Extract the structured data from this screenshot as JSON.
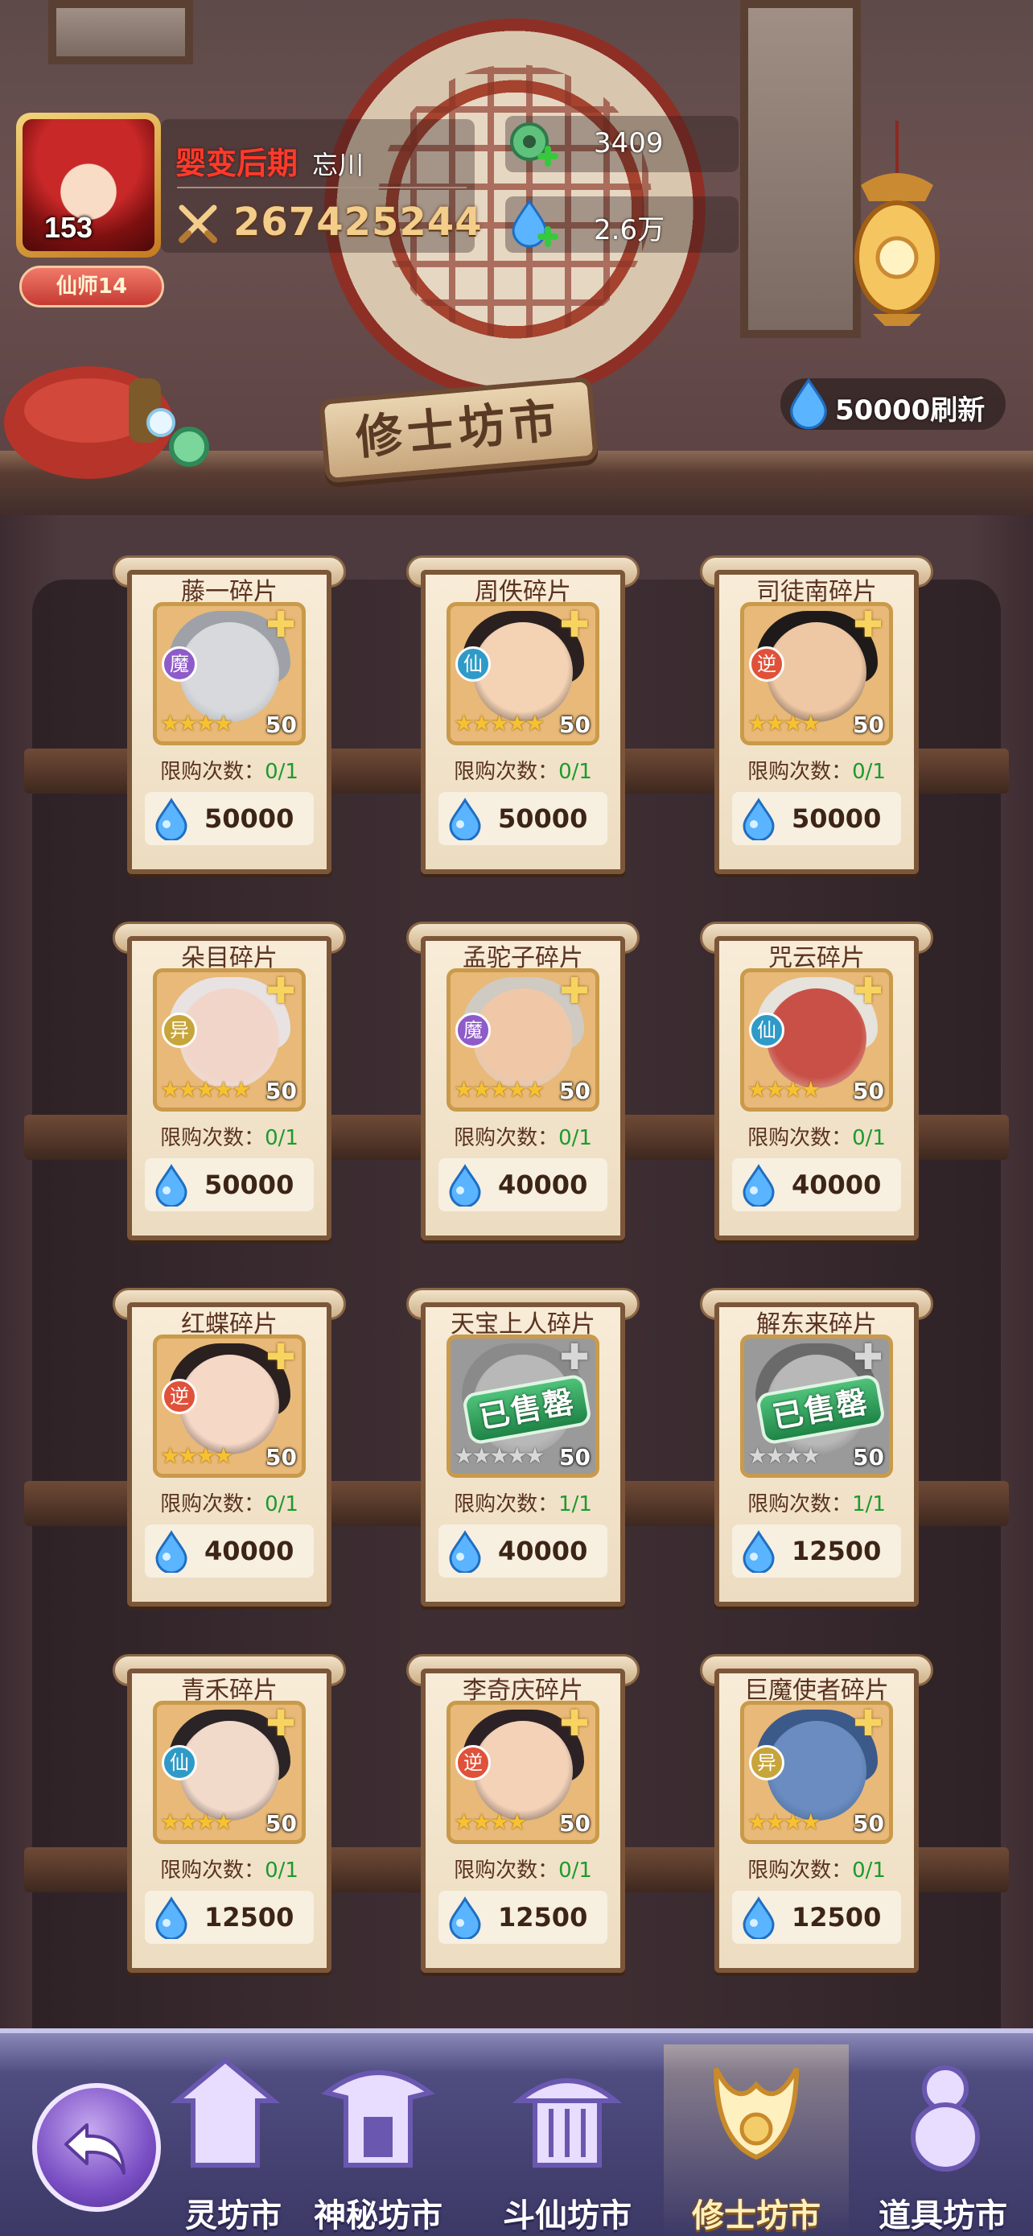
{
  "header": {
    "avatar_level": "153",
    "rank_badge": "仙师14",
    "realm": "婴变后期",
    "player_name": "忘川",
    "combat_power": "267425244",
    "resources": [
      {
        "icon": "jade-coin-icon",
        "value": "3409"
      },
      {
        "icon": "spirit-water-icon",
        "value": "2.6万"
      }
    ],
    "refresh_label": "50000刷新",
    "shop_title": "修士坊市"
  },
  "shop": {
    "limit_label": "限购次数：",
    "soldout_label": "已售罄",
    "items": [
      {
        "name": "藤一碎片",
        "faction": "魔",
        "count": "50",
        "stars": 4,
        "limit": "0/1",
        "price": "50000",
        "sold_out": false,
        "colors": {
          "face": "#d7d9dd",
          "hair": "#9ea2a8",
          "faction": "#8e5bc9"
        }
      },
      {
        "name": "周佚碎片",
        "faction": "仙",
        "count": "50",
        "stars": 5,
        "limit": "0/1",
        "price": "50000",
        "sold_out": false,
        "colors": {
          "face": "#f4d2b4",
          "hair": "#2b2020",
          "faction": "#2f9ac7"
        }
      },
      {
        "name": "司徒南碎片",
        "faction": "逆",
        "count": "50",
        "stars": 4,
        "limit": "0/1",
        "price": "50000",
        "sold_out": false,
        "colors": {
          "face": "#eec7a4",
          "hair": "#1f1a1a",
          "faction": "#e0513a"
        }
      },
      {
        "name": "朵目碎片",
        "faction": "异",
        "count": "50",
        "stars": 5,
        "limit": "0/1",
        "price": "50000",
        "sold_out": false,
        "colors": {
          "face": "#f1d5c8",
          "hair": "#e8e2e2",
          "faction": "#c7a53b"
        }
      },
      {
        "name": "孟驼子碎片",
        "faction": "魔",
        "count": "50",
        "stars": 5,
        "limit": "0/1",
        "price": "40000",
        "sold_out": false,
        "colors": {
          "face": "#f0c8a8",
          "hair": "#cfcac2",
          "faction": "#8e5bc9"
        }
      },
      {
        "name": "咒云碎片",
        "faction": "仙",
        "count": "50",
        "stars": 4,
        "limit": "0/1",
        "price": "40000",
        "sold_out": false,
        "colors": {
          "face": "#c85046",
          "hair": "#e6e2dc",
          "faction": "#2f9ac7"
        }
      },
      {
        "name": "红蝶碎片",
        "faction": "逆",
        "count": "50",
        "stars": 4,
        "limit": "0/1",
        "price": "40000",
        "sold_out": false,
        "colors": {
          "face": "#f6d8c6",
          "hair": "#2a2020",
          "faction": "#e0513a"
        }
      },
      {
        "name": "天宝上人碎片",
        "faction": "",
        "count": "50",
        "stars": 5,
        "limit": "1/1",
        "price": "40000",
        "sold_out": true,
        "colors": {
          "face": "#b8b8b8",
          "hair": "#8a8a8a",
          "faction": "#888888"
        }
      },
      {
        "name": "解东来碎片",
        "faction": "",
        "count": "50",
        "stars": 4,
        "limit": "1/1",
        "price": "12500",
        "sold_out": true,
        "colors": {
          "face": "#b8b8b8",
          "hair": "#6a6a6a",
          "faction": "#888888"
        }
      },
      {
        "name": "青禾碎片",
        "faction": "仙",
        "count": "50",
        "stars": 4,
        "limit": "0/1",
        "price": "12500",
        "sold_out": false,
        "colors": {
          "face": "#f2dacb",
          "hair": "#2a2426",
          "faction": "#2f9ac7"
        }
      },
      {
        "name": "李奇庆碎片",
        "faction": "逆",
        "count": "50",
        "stars": 4,
        "limit": "0/1",
        "price": "12500",
        "sold_out": false,
        "colors": {
          "face": "#f3d2b8",
          "hair": "#2c2226",
          "faction": "#e0513a"
        }
      },
      {
        "name": "巨魔使者碎片",
        "faction": "异",
        "count": "50",
        "stars": 4,
        "limit": "0/1",
        "price": "12500",
        "sold_out": false,
        "colors": {
          "face": "#6a8cc0",
          "hair": "#3b5a8a",
          "faction": "#c7a53b"
        }
      }
    ]
  },
  "bottom_nav": {
    "tabs": [
      {
        "label": "灵坊市",
        "icon": "market-building-icon",
        "active": false
      },
      {
        "label": "神秘坊市",
        "icon": "mystery-pavilion-icon",
        "active": false
      },
      {
        "label": "斗仙坊市",
        "icon": "arena-pavilion-icon",
        "active": false
      },
      {
        "label": "修士坊市",
        "icon": "cultivator-emblem-icon",
        "active": true
      },
      {
        "label": "道具坊市",
        "icon": "item-gourd-icon",
        "active": false
      }
    ]
  },
  "colors": {
    "accent_gold": "#f3cd8a",
    "realm_red": "#ff3a2a",
    "limit_green": "#1d9a2e",
    "nav_purple": "#4f4c80"
  }
}
